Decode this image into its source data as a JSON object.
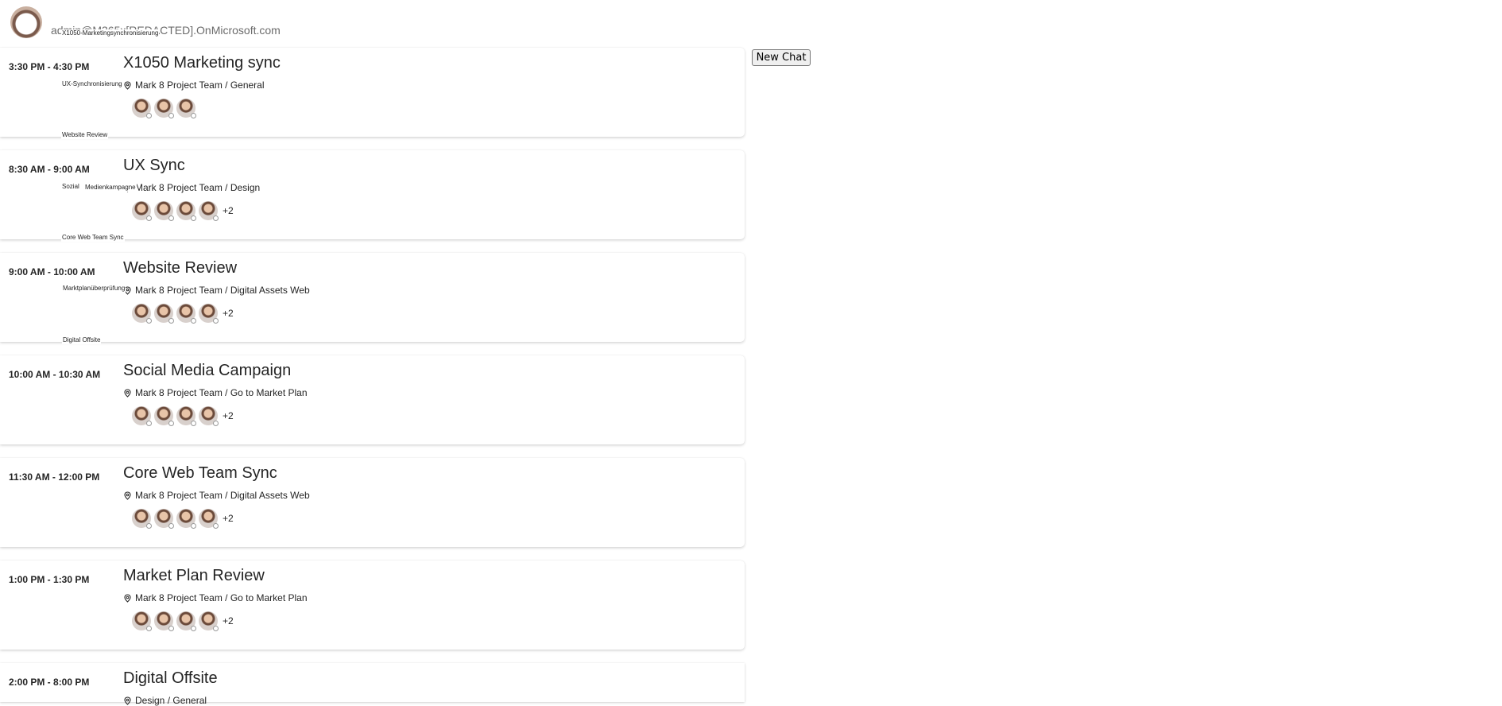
{
  "header": {
    "account": "admin@M365x[REDACTED].OnMicrosoft.com"
  },
  "overlay_labels": [
    "X1050-Marketingsynchronisierung",
    "UX-Synchronisierung",
    "Website Review",
    "Sozial",
    "Medienkampagne",
    "Core Web Team Sync",
    "Marktplanüberprüfung",
    "Digital Offsite"
  ],
  "toolbar": {
    "new_chat_label": "New Chat"
  },
  "meetings": [
    {
      "time": "3:30 PM - 4:30 PM",
      "title": "X1050 Marketing sync",
      "location": "Mark 8 Project Team / General",
      "attendees": 3,
      "more": ""
    },
    {
      "time": "8:30 AM - 9:00 AM",
      "title": "UX Sync",
      "location": "Mark 8 Project Team / Design",
      "attendees": 4,
      "more": "+2"
    },
    {
      "time": "9:00 AM - 10:00 AM",
      "title": "Website Review",
      "location": "Mark 8 Project Team / Digital Assets Web",
      "attendees": 4,
      "more": "+2"
    },
    {
      "time": "10:00 AM - 10:30 AM",
      "title": "Social Media Campaign",
      "location": "Mark 8 Project Team / Go to Market Plan",
      "attendees": 4,
      "more": "+2"
    },
    {
      "time": "11:30 AM - 12:00 PM",
      "title": "Core Web Team Sync",
      "location": "Mark 8 Project Team / Digital Assets Web",
      "attendees": 4,
      "more": "+2"
    },
    {
      "time": "1:00 PM - 1:30 PM",
      "title": "Market Plan Review",
      "location": "Mark 8 Project Team / Go to Market Plan",
      "attendees": 4,
      "more": "+2"
    },
    {
      "time": "2:00 PM - 8:00 PM",
      "title": "Digital Offsite",
      "location": "Design / General",
      "attendees": 0,
      "more": ""
    }
  ]
}
